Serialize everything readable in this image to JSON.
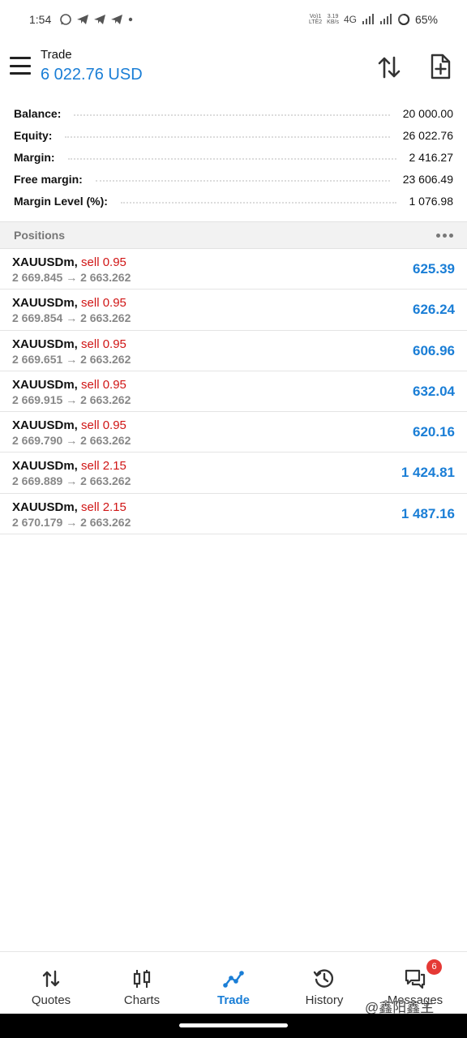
{
  "status_bar": {
    "time": "1:54",
    "net_type_top": "Vo)1",
    "net_type_bottom": "LTE2",
    "speed_top": "3.19",
    "speed_bottom": "KB/s",
    "network": "4G",
    "battery": "65%"
  },
  "header": {
    "title": "Trade",
    "subtitle": "6 022.76 USD"
  },
  "summary": [
    {
      "label": "Balance:",
      "value": "20 000.00"
    },
    {
      "label": "Equity:",
      "value": "26 022.76"
    },
    {
      "label": "Margin:",
      "value": "2 416.27"
    },
    {
      "label": "Free margin:",
      "value": "23 606.49"
    },
    {
      "label": "Margin Level (%):",
      "value": "1 076.98"
    }
  ],
  "positions_header": "Positions",
  "positions": [
    {
      "symbol": "XAUUSDm,",
      "side": "sell 0.95",
      "open": "2 669.845",
      "arrow": "→",
      "current": "2 663.262",
      "profit": "625.39"
    },
    {
      "symbol": "XAUUSDm,",
      "side": "sell 0.95",
      "open": "2 669.854",
      "arrow": "→",
      "current": "2 663.262",
      "profit": "626.24"
    },
    {
      "symbol": "XAUUSDm,",
      "side": "sell 0.95",
      "open": "2 669.651",
      "arrow": "→",
      "current": "2 663.262",
      "profit": "606.96"
    },
    {
      "symbol": "XAUUSDm,",
      "side": "sell 0.95",
      "open": "2 669.915",
      "arrow": "→",
      "current": "2 663.262",
      "profit": "632.04"
    },
    {
      "symbol": "XAUUSDm,",
      "side": "sell 0.95",
      "open": "2 669.790",
      "arrow": "→",
      "current": "2 663.262",
      "profit": "620.16"
    },
    {
      "symbol": "XAUUSDm,",
      "side": "sell 2.15",
      "open": "2 669.889",
      "arrow": "→",
      "current": "2 663.262",
      "profit": "1 424.81"
    },
    {
      "symbol": "XAUUSDm,",
      "side": "sell 2.15",
      "open": "2 670.179",
      "arrow": "→",
      "current": "2 663.262",
      "profit": "1 487.16"
    }
  ],
  "nav": {
    "quotes": "Quotes",
    "charts": "Charts",
    "trade": "Trade",
    "history": "History",
    "messages": "Messages",
    "messages_badge": "6"
  },
  "watermark": "@鑫阳鑫主",
  "colors": {
    "accent": "#1a7ed6",
    "sell": "#d01515",
    "badge": "#e53935"
  }
}
